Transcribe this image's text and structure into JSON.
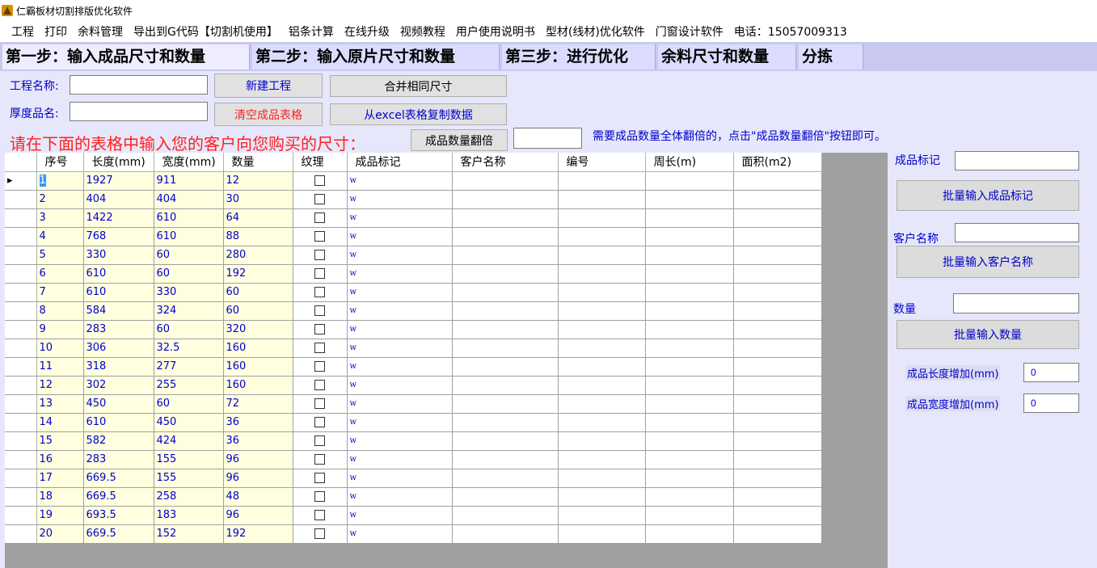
{
  "window": {
    "title": "仁霸板材切割排版优化软件",
    "icon": "app-logo-icon"
  },
  "menu": [
    "工程",
    "打印",
    "余料管理",
    "导出到G代码【切割机使用】",
    "铝条计算",
    "在线升级",
    "视频教程",
    "用户使用说明书",
    "型材(线材)优化软件",
    "门窗设计软件",
    "电话：15057009313"
  ],
  "steps": [
    {
      "label": "第一步：输入成品尺寸和数量",
      "active": true
    },
    {
      "label": "第二步：输入原片尺寸和数量",
      "active": false
    },
    {
      "label": "第三步：进行优化",
      "active": false
    },
    {
      "label": "余料尺寸和数量",
      "active": false
    },
    {
      "label": "分拣",
      "active": false
    }
  ],
  "form": {
    "project_name_label": "工程名称:",
    "project_name_value": "",
    "thickness_label": "厚度品名:",
    "thickness_value": "",
    "new_project_btn": "新建工程",
    "clear_table_btn": "清空成品表格",
    "merge_btn": "合并相同尺寸",
    "excel_btn": "从excel表格复制数据",
    "double_btn": "成品数量翻倍",
    "double_value": "",
    "instruction_red": "请在下面的表格中输入您的客户向您购买的尺寸：",
    "instruction_blue": "需要成品数量全体翻倍的，点击\"成品数量翻倍\"按钮即可。"
  },
  "table": {
    "columns": [
      "序号",
      "长度(mm)",
      "宽度(mm)",
      "数量",
      "纹理",
      "成品标记",
      "客户名称",
      "编号",
      "周长(m)",
      "面积(m2)"
    ],
    "rows": [
      [
        "1",
        "1927",
        "911",
        "12",
        "",
        "w",
        "",
        "",
        "",
        ""
      ],
      [
        "2",
        "404",
        "404",
        "30",
        "",
        "w",
        "",
        "",
        "",
        ""
      ],
      [
        "3",
        "1422",
        "610",
        "64",
        "",
        "w",
        "",
        "",
        "",
        ""
      ],
      [
        "4",
        "768",
        "610",
        "88",
        "",
        "w",
        "",
        "",
        "",
        ""
      ],
      [
        "5",
        "330",
        "60",
        "280",
        "",
        "w",
        "",
        "",
        "",
        ""
      ],
      [
        "6",
        "610",
        "60",
        "192",
        "",
        "w",
        "",
        "",
        "",
        ""
      ],
      [
        "7",
        "610",
        "330",
        "60",
        "",
        "w",
        "",
        "",
        "",
        ""
      ],
      [
        "8",
        "584",
        "324",
        "60",
        "",
        "w",
        "",
        "",
        "",
        ""
      ],
      [
        "9",
        "283",
        "60",
        "320",
        "",
        "w",
        "",
        "",
        "",
        ""
      ],
      [
        "10",
        "306",
        "32.5",
        "160",
        "",
        "w",
        "",
        "",
        "",
        ""
      ],
      [
        "11",
        "318",
        "277",
        "160",
        "",
        "w",
        "",
        "",
        "",
        ""
      ],
      [
        "12",
        "302",
        "255",
        "160",
        "",
        "w",
        "",
        "",
        "",
        ""
      ],
      [
        "13",
        "450",
        "60",
        "72",
        "",
        "w",
        "",
        "",
        "",
        ""
      ],
      [
        "14",
        "610",
        "450",
        "36",
        "",
        "w",
        "",
        "",
        "",
        ""
      ],
      [
        "15",
        "582",
        "424",
        "36",
        "",
        "w",
        "",
        "",
        "",
        ""
      ],
      [
        "16",
        "283",
        "155",
        "96",
        "",
        "w",
        "",
        "",
        "",
        ""
      ],
      [
        "17",
        "669.5",
        "155",
        "96",
        "",
        "w",
        "",
        "",
        "",
        ""
      ],
      [
        "18",
        "669.5",
        "258",
        "48",
        "",
        "w",
        "",
        "",
        "",
        ""
      ],
      [
        "19",
        "693.5",
        "183",
        "96",
        "",
        "w",
        "",
        "",
        "",
        ""
      ],
      [
        "20",
        "669.5",
        "152",
        "192",
        "",
        "w",
        "",
        "",
        "",
        ""
      ]
    ]
  },
  "right_panel": {
    "mark_label": "成品标记",
    "mark_value": "",
    "mark_btn": "批量输入成品标记",
    "customer_label": "客户名称",
    "customer_value": "",
    "customer_btn": "批量输入客户名称",
    "qty_label": "数量",
    "qty_value": "",
    "qty_btn": "批量输入数量",
    "length_add_label": "成品长度增加(mm)",
    "length_add_value": "0",
    "width_add_label": "成品宽度增加(mm)",
    "width_add_value": "0"
  },
  "colors": {
    "tab_bg": "#c8c8f0",
    "panel_bg": "#e7e7fb",
    "link_blue": "#0000cc",
    "warning_red": "#ff2020",
    "yellow_cell": "#ffffe0"
  }
}
